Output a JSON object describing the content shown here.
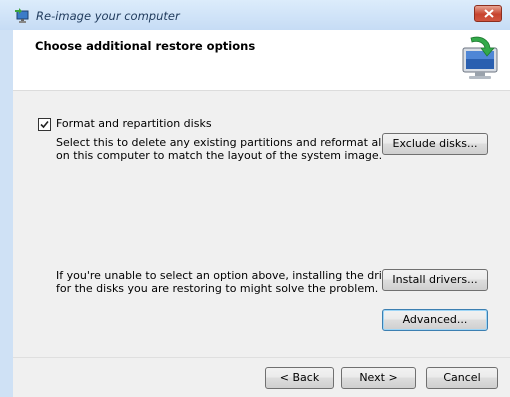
{
  "window": {
    "title": "Re-image your computer"
  },
  "header": {
    "title": "Choose additional restore options",
    "icon": "computer-restore-icon"
  },
  "options": {
    "format_checkbox": {
      "label": "Format and repartition disks",
      "checked": true
    },
    "format_desc_line1": "Select this to delete any existing partitions and reformat all disks",
    "format_desc_line2": "on this computer to match the layout of the system image.",
    "exclude_disks_label": "Exclude disks...",
    "drivers_info_line1": "If you're unable to select an option above, installing the drivers",
    "drivers_info_line2": "for the disks you are restoring to might solve the problem.",
    "install_drivers_label": "Install drivers...",
    "advanced_label": "Advanced..."
  },
  "footer": {
    "back_label": "< Back",
    "next_label": "Next >",
    "cancel_label": "Cancel"
  },
  "colors": {
    "titlebar": "#c6dcf5",
    "close_button": "#c7442f",
    "dialog_bg": "#f0f0f0",
    "default_button_border": "#3c7fb1"
  }
}
